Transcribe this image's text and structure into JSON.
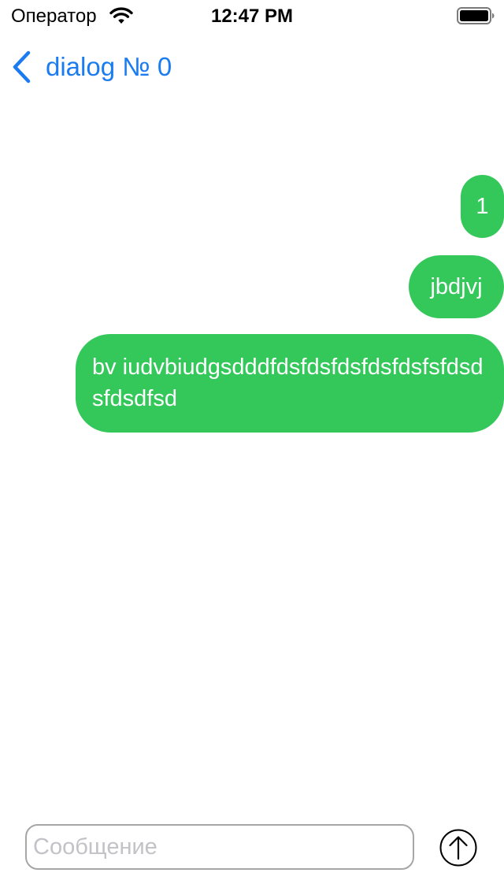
{
  "status_bar": {
    "carrier": "Оператор",
    "time": "12:47 PM",
    "wifi_icon": "wifi-icon",
    "battery_icon": "battery-full-icon"
  },
  "nav_bar": {
    "back_icon": "chevron-left-icon",
    "title": "dialog № 0",
    "accent_color": "#1a7cf0"
  },
  "messages": [
    {
      "text": "1",
      "direction": "outgoing"
    },
    {
      "text": "jbdjvj",
      "direction": "outgoing"
    },
    {
      "text": "bv iudvbiudgsdddfdsfdsfdsfdsfdsfsfdsdsfdsdfsd",
      "direction": "outgoing"
    }
  ],
  "bubble_color": "#34c75a",
  "composer": {
    "value": "",
    "placeholder": "Сообщение",
    "send_icon": "arrow-up-circle-icon"
  }
}
